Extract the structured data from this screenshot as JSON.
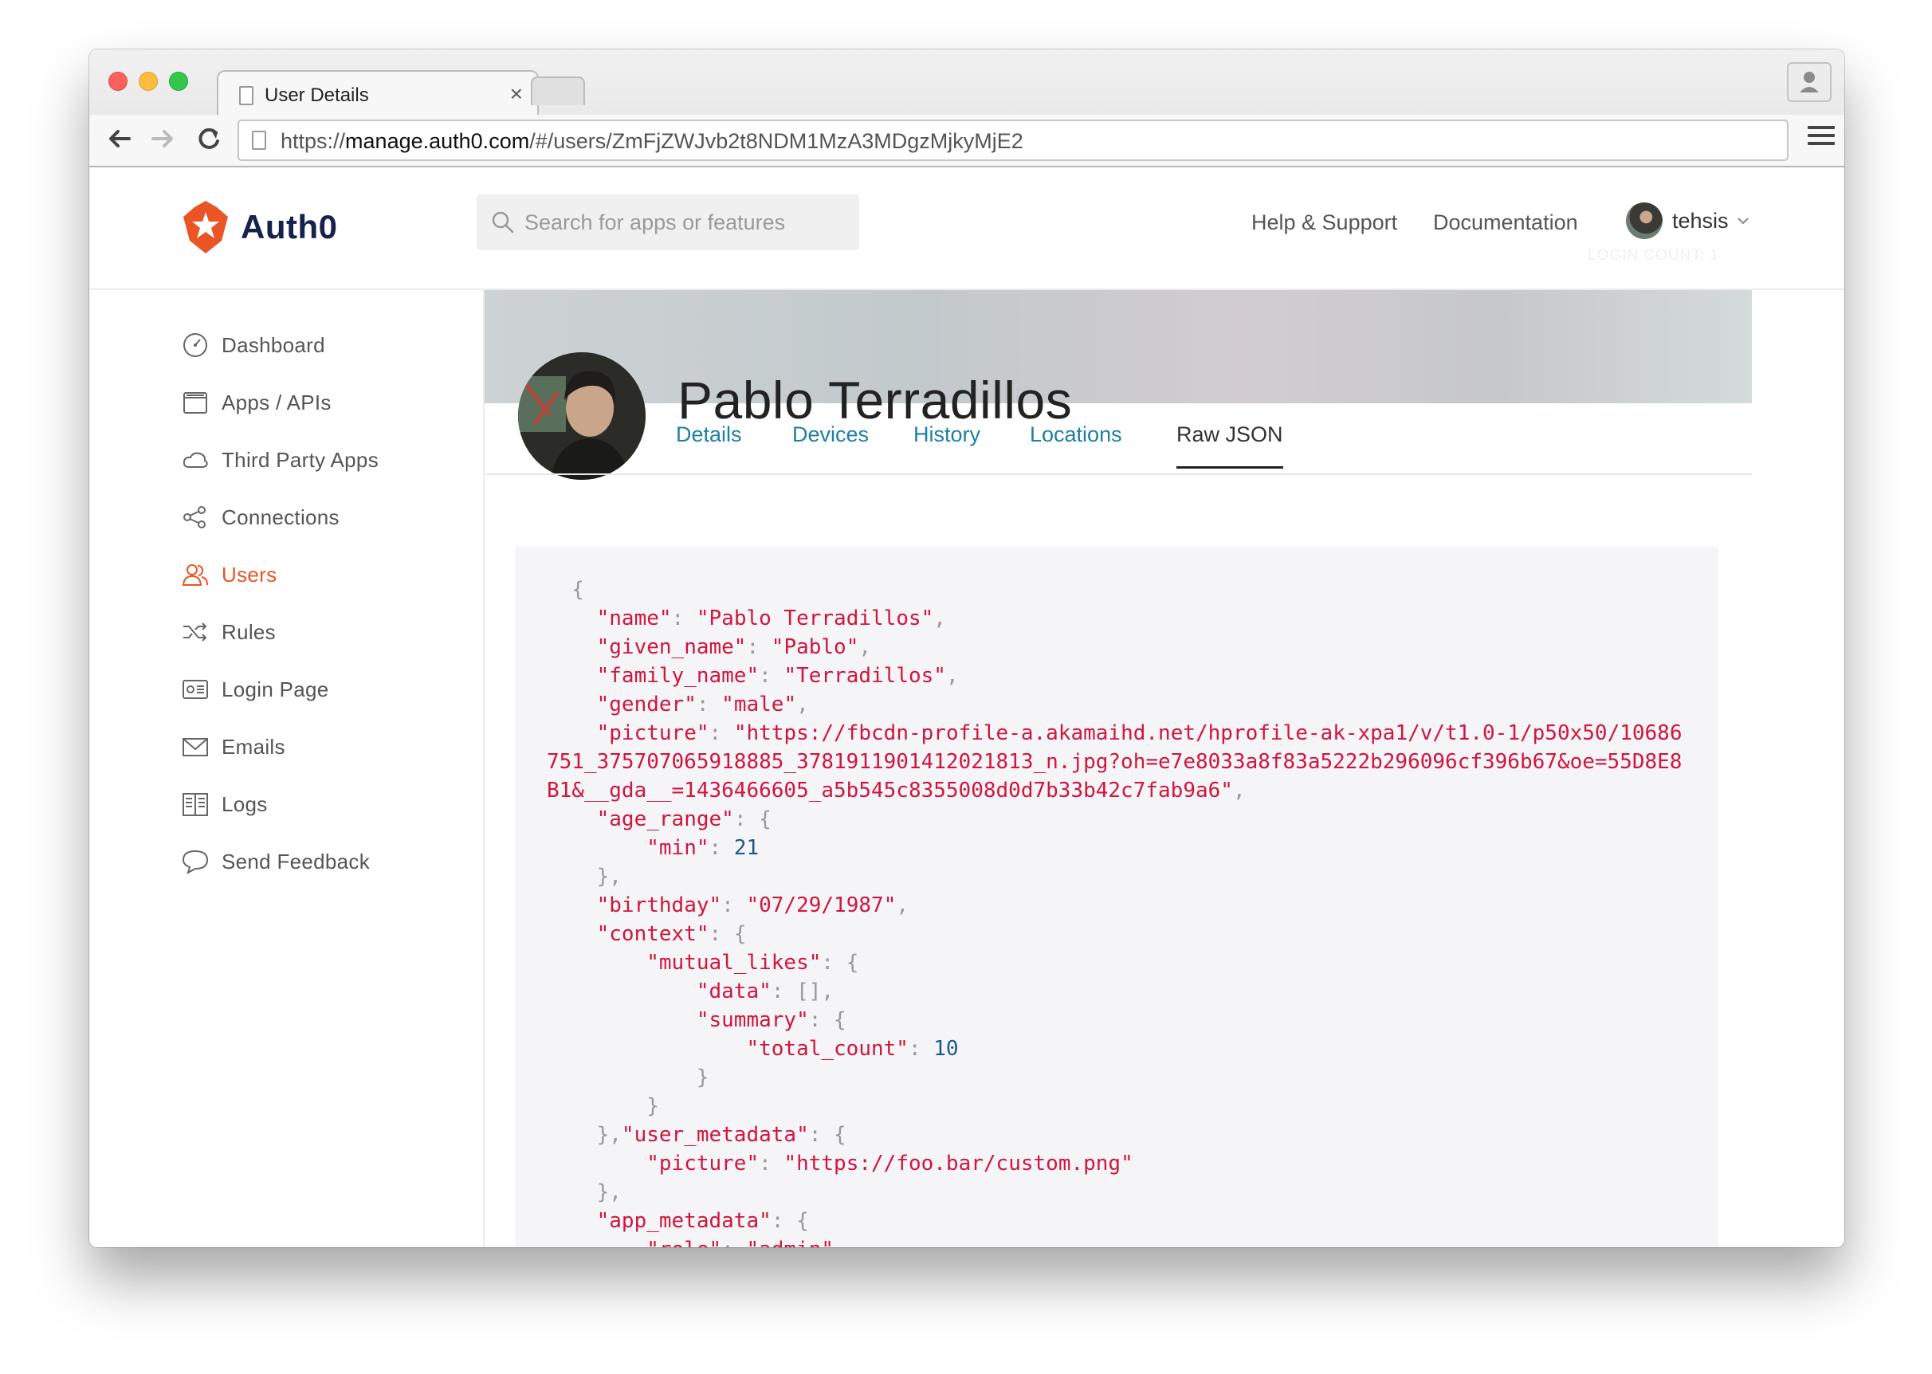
{
  "browser": {
    "tab_title": "User Details",
    "tab_close": "×",
    "url_prefix": "https://",
    "url_host": "manage.auth0.com",
    "url_path": "/#/users/ZmFjZWJvb2t8NDM1MzA3MDgzMjkyMjE2"
  },
  "header": {
    "logo_text": "Auth0",
    "search_placeholder": "Search for apps or features",
    "links": [
      "Help & Support",
      "Documentation"
    ],
    "user_name": "tehsis",
    "login_count": "LOGIN COUNT: 1"
  },
  "sidebar": {
    "items": [
      {
        "label": "Dashboard",
        "icon": "dashboard-icon"
      },
      {
        "label": "Apps / APIs",
        "icon": "apps-icon"
      },
      {
        "label": "Third Party Apps",
        "icon": "cloud-icon"
      },
      {
        "label": "Connections",
        "icon": "connections-icon"
      },
      {
        "label": "Users",
        "icon": "users-icon",
        "active": true
      },
      {
        "label": "Rules",
        "icon": "shuffle-icon"
      },
      {
        "label": "Login Page",
        "icon": "login-page-icon"
      },
      {
        "label": "Emails",
        "icon": "envelope-icon"
      },
      {
        "label": "Logs",
        "icon": "book-icon"
      },
      {
        "label": "Send Feedback",
        "icon": "speech-bubble-icon"
      }
    ]
  },
  "profile": {
    "name": "Pablo Terradillos",
    "tabs": [
      "Details",
      "Devices",
      "History",
      "Locations",
      "Raw JSON"
    ],
    "active_tab": "Raw JSON"
  },
  "raw_json": {
    "name": "Pablo Terradillos",
    "given_name": "Pablo",
    "family_name": "Terradillos",
    "gender": "male",
    "picture_line1": "https://fbcdn-profile-a.akamaihd.net/hprofile-ak-xpa1/v/t1.0-1/p50x50/10686",
    "picture_line2": "751_375707065918885_3781911901412021813_n.jpg?oh=e7e8033a8f83a5222b296096cf396b67&oe=55D8E8",
    "picture_line3": "B1&__gda__=1436466605_a5b545c8355008d0d7b33b42c7fab9a6",
    "age_range_min": "21",
    "birthday": "07/29/1987",
    "total_count": "10",
    "user_metadata_picture": "https://foo.bar/custom.png",
    "role": "admin"
  },
  "colors": {
    "brand": "#eb5424",
    "tab_link": "#1e7fa5",
    "json_string": "#d0153e",
    "json_number": "#1a5a8a"
  }
}
